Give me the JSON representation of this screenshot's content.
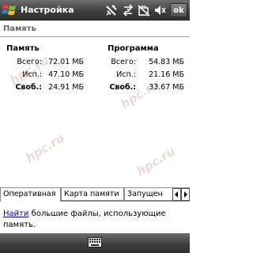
{
  "titlebar": {
    "title": "Настройка",
    "ok_label": "ok",
    "icons": [
      "windows-start-icon",
      "connectivity-icon",
      "signal-icon",
      "sync-icon",
      "volume-icon"
    ]
  },
  "page": {
    "heading": "Память"
  },
  "memory": {
    "storage": {
      "title": "Память",
      "rows": [
        {
          "label": "Всего:",
          "value": "72.01 МБ"
        },
        {
          "label": "Исп.:",
          "value": "47.10 МБ"
        },
        {
          "label": "Своб.:",
          "value": "24.91 МБ"
        }
      ]
    },
    "program": {
      "title": "Программа",
      "rows": [
        {
          "label": "Всего:",
          "value": "54.83 МБ"
        },
        {
          "label": "Исп.:",
          "value": "21.16 МБ"
        },
        {
          "label": "Своб.:",
          "value": "33.67 МБ"
        }
      ]
    }
  },
  "watermark": {
    "text": "hpc.ru"
  },
  "tabs": [
    {
      "label": "Оперативная",
      "active": true
    },
    {
      "label": "Карта памяти",
      "active": false
    },
    {
      "label": "Запущен",
      "active": false
    }
  ],
  "footer": {
    "link": "Найти",
    "text": " большие файлы, использующие память."
  },
  "menubar": {
    "icon": "keyboard-icon"
  },
  "colors": {
    "titlebar": "#3f3f3f",
    "link": "#0000cc",
    "watermark": "#f1d8d8"
  }
}
